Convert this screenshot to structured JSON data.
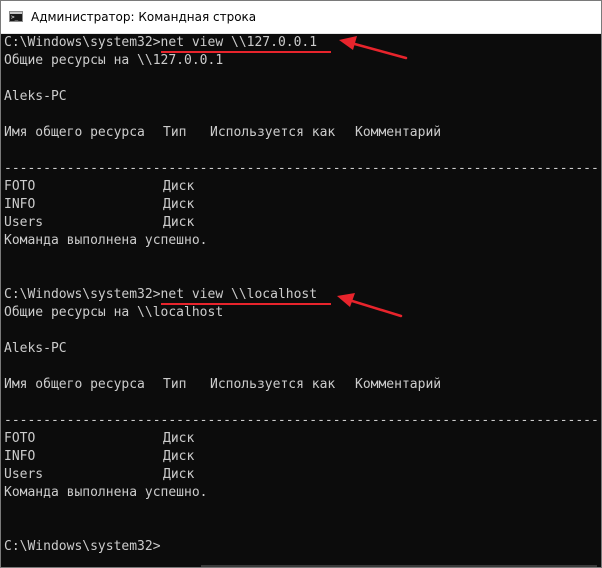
{
  "window": {
    "title": "Администратор: Командная строка",
    "icon": "cmd-icon",
    "icon_glyph": ">_"
  },
  "session1": {
    "prompt": "C:\\Windows\\system32>",
    "command": "net view \\\\127.0.0.1",
    "resources_header": "Общие ресурсы на \\\\127.0.0.1",
    "computer": "Aleks-PC",
    "columns": [
      "Имя общего ресурса",
      "Тип",
      "Используется как",
      "Комментарий"
    ],
    "separator": "-------------------------------------------------------------------------------",
    "shares": [
      {
        "name": "FOTO",
        "type": "Диск"
      },
      {
        "name": "INFO",
        "type": "Диск"
      },
      {
        "name": "Users",
        "type": "Диск"
      }
    ],
    "result": "Команда выполнена успешно."
  },
  "session2": {
    "prompt": "C:\\Windows\\system32>",
    "command": "net view \\\\localhost",
    "resources_header": "Общие ресурсы на \\\\localhost",
    "computer": "Aleks-PC",
    "columns": [
      "Имя общего ресурса",
      "Тип",
      "Используется как",
      "Комментарий"
    ],
    "separator": "-------------------------------------------------------------------------------",
    "shares": [
      {
        "name": "FOTO",
        "type": "Диск"
      },
      {
        "name": "INFO",
        "type": "Диск"
      },
      {
        "name": "Users",
        "type": "Диск"
      }
    ],
    "result": "Команда выполнена успешно."
  },
  "final_prompt": "C:\\Windows\\system32>",
  "colors": {
    "console_bg": "#0c0c0c",
    "console_text": "#cccccc",
    "annotation": "#e8242c"
  }
}
